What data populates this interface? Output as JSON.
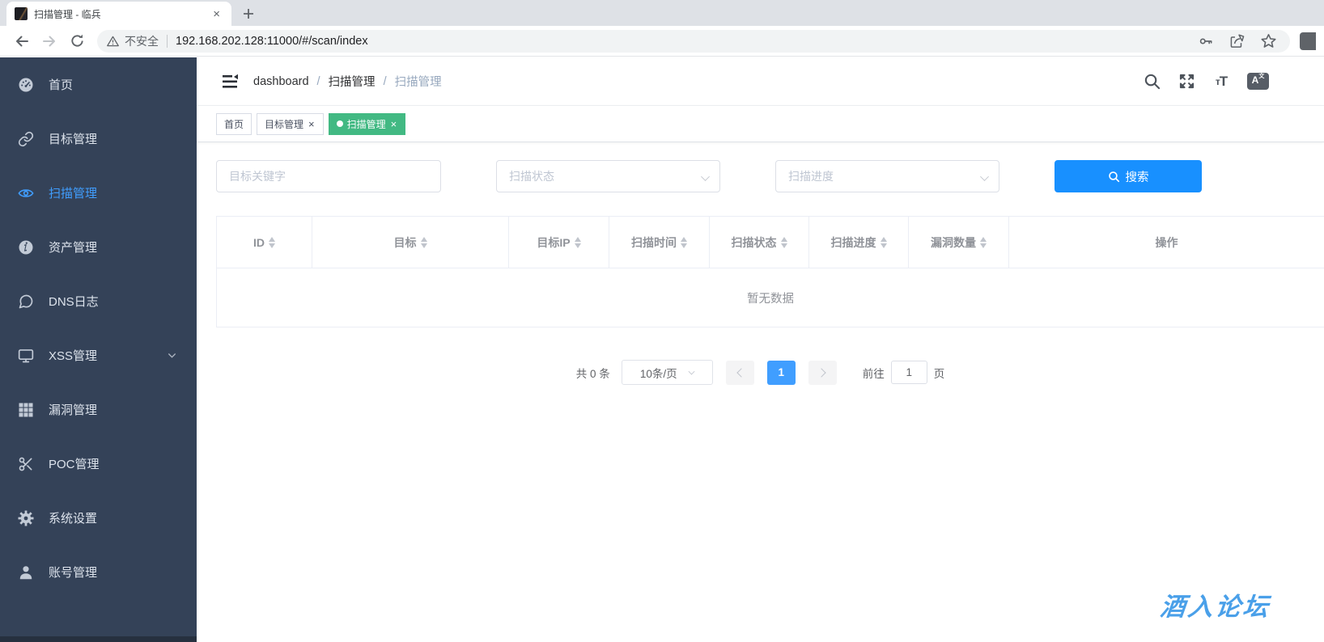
{
  "browser": {
    "tab_title": "扫描管理 - 临兵",
    "security_label": "不安全",
    "url": "192.168.202.128:11000/#/scan/index"
  },
  "navbar": {
    "breadcrumb": {
      "0": "dashboard",
      "1": "扫描管理",
      "2": "扫描管理"
    }
  },
  "tags": {
    "home": "首页",
    "targets": "目标管理",
    "scan": "扫描管理"
  },
  "sidebar": {
    "items": [
      {
        "label": "首页",
        "icon": "dashboard-icon"
      },
      {
        "label": "目标管理",
        "icon": "link-icon"
      },
      {
        "label": "扫描管理",
        "icon": "eye-icon"
      },
      {
        "label": "资产管理",
        "icon": "info-icon"
      },
      {
        "label": "DNS日志",
        "icon": "chat-icon"
      },
      {
        "label": "XSS管理",
        "icon": "monitor-icon"
      },
      {
        "label": "漏洞管理",
        "icon": "grid-icon"
      },
      {
        "label": "POC管理",
        "icon": "scissors-icon"
      },
      {
        "label": "系统设置",
        "icon": "gear-icon"
      },
      {
        "label": "账号管理",
        "icon": "user-icon"
      }
    ]
  },
  "filters": {
    "keyword_placeholder": "目标关键字",
    "status_placeholder": "扫描状态",
    "progress_placeholder": "扫描进度",
    "search_label": "搜索"
  },
  "table": {
    "columns": [
      "ID",
      "目标",
      "目标IP",
      "扫描时间",
      "扫描状态",
      "扫描进度",
      "漏洞数量",
      "操作"
    ],
    "empty_text": "暂无数据"
  },
  "pagination": {
    "total_text": "共 0 条",
    "page_size": "10条/页",
    "current_page": "1",
    "goto_label": "前往",
    "goto_value": "1",
    "page_label": "页"
  },
  "icons": {
    "close": "×",
    "plus": "+"
  },
  "watermark": "酒入论坛",
  "colors": {
    "primary_blue": "#1890ff",
    "active_link_blue": "#409EFF",
    "tag_active_green": "#42b983",
    "sidebar_bg": "#344258",
    "watermark_blue": "#4aa0e9"
  }
}
